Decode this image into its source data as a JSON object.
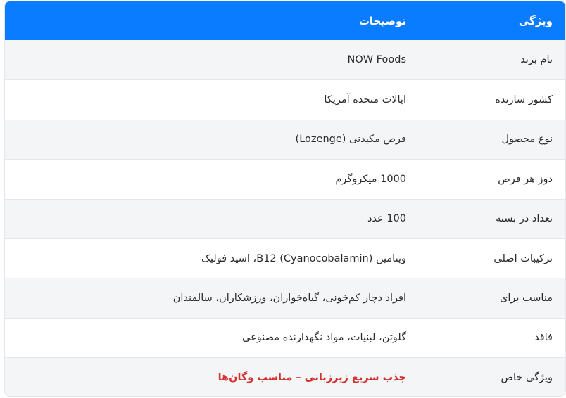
{
  "header": {
    "feature": "ویژگی",
    "description": "توضیحات"
  },
  "rows": [
    {
      "feature": "نام برند",
      "value": "NOW Foods"
    },
    {
      "feature": "کشور سازنده",
      "value": "ایالات متحده آمریکا"
    },
    {
      "feature": "نوع محصول",
      "value": "قرص مکیدنی (Lozenge)"
    },
    {
      "feature": "دوز هر قرص",
      "value": "1000 میکروگرم"
    },
    {
      "feature": "تعداد در بسته",
      "value": "100 عدد"
    },
    {
      "feature": "ترکیبات اصلی",
      "value": "ویتامین B12 (Cyanocobalamin)، اسید فولیک"
    },
    {
      "feature": "مناسب برای",
      "value": "افراد دچار کم‌خونی، گیاه‌خواران، ورزشکاران، سالمندان"
    },
    {
      "feature": "فاقد",
      "value": "گلوتن، لبنیات، مواد نگهدارنده مصنوعی"
    },
    {
      "feature": "ویژگی خاص",
      "value": "جذب سریع زیرزبانی – مناسب وگان‌ها"
    }
  ],
  "colors": {
    "header_bg": "#0a7cff",
    "highlight": "#d32f2f"
  }
}
